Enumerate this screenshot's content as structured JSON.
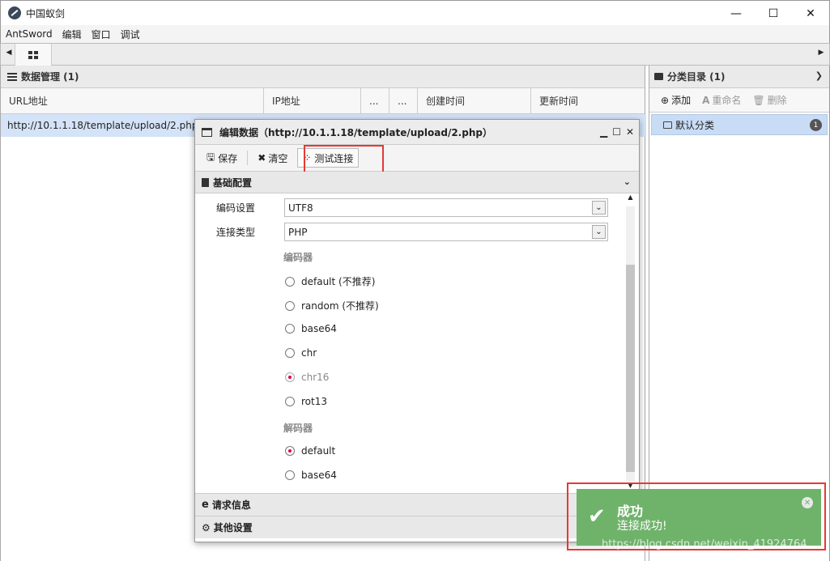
{
  "window": {
    "title": "中国蚁剑",
    "minimize": "—",
    "maximize": "☐",
    "close": "✕"
  },
  "menu": [
    "AntSword",
    "编辑",
    "窗口",
    "调试"
  ],
  "data_panel": {
    "title": "数据管理 (1)",
    "columns": [
      "URL地址",
      "IP地址",
      "...",
      "...",
      "创建时间",
      "更新时间"
    ],
    "rows": [
      {
        "url": "http://10.1.1.18/template/upload/2.php"
      }
    ]
  },
  "category_panel": {
    "title": "分类目录 (1)",
    "add": "添加",
    "rename": "重命名",
    "delete": "删除",
    "items": [
      {
        "label": "默认分类",
        "count": "1"
      }
    ]
  },
  "dialog": {
    "title": "编辑数据（http://10.1.1.18/template/upload/2.php）",
    "save": "保存",
    "clear": "清空",
    "test": "测试连接",
    "basic_section": "基础配置",
    "encoding_label": "编码设置",
    "encoding_value": "UTF8",
    "type_label": "连接类型",
    "type_value": "PHP",
    "encoder_label": "编码器",
    "encoders": [
      "default (不推荐)",
      "random (不推荐)",
      "base64",
      "chr",
      "chr16",
      "rot13"
    ],
    "decoder_label": "解码器",
    "decoders": [
      "default",
      "base64"
    ],
    "request_section": "请求信息",
    "other_section": "其他设置"
  },
  "toast": {
    "title": "成功",
    "message": "连接成功!",
    "watermark": "https://blog.csdn.net/weixin_41924764",
    "color": "#6fb36b"
  }
}
